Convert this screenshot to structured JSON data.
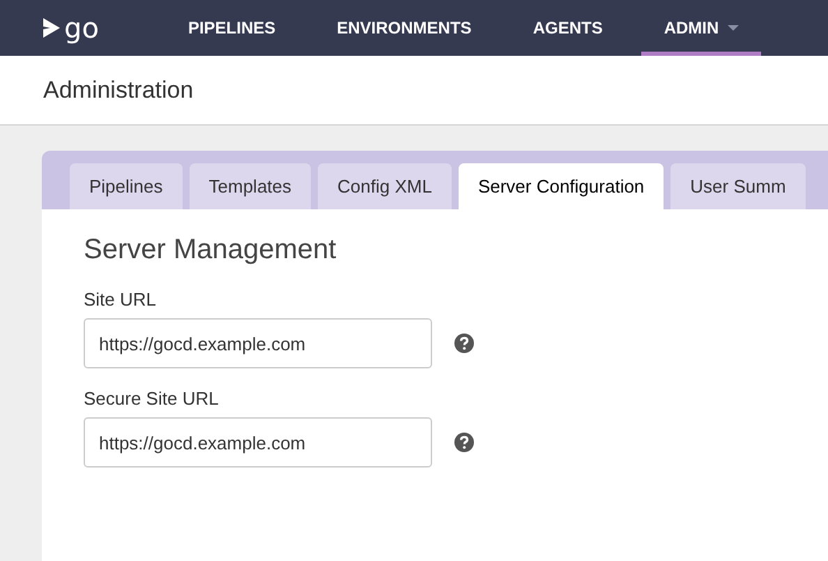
{
  "nav": {
    "logo": "go",
    "items": [
      {
        "label": "PIPELINES",
        "selected": false,
        "dropdown": false
      },
      {
        "label": "ENVIRONMENTS",
        "selected": false,
        "dropdown": false
      },
      {
        "label": "AGENTS",
        "selected": false,
        "dropdown": false
      },
      {
        "label": "ADMIN",
        "selected": true,
        "dropdown": true
      }
    ]
  },
  "page_title": "Administration",
  "tabs": [
    {
      "label": "Pipelines",
      "selected": false
    },
    {
      "label": "Templates",
      "selected": false
    },
    {
      "label": "Config XML",
      "selected": false
    },
    {
      "label": "Server Configuration",
      "selected": true
    },
    {
      "label": "User Summ",
      "selected": false
    }
  ],
  "section": {
    "title": "Server Management",
    "fields": [
      {
        "label": "Site URL",
        "value": "https://gocd.example.com"
      },
      {
        "label": "Secure Site URL",
        "value": "https://gocd.example.com"
      }
    ]
  }
}
